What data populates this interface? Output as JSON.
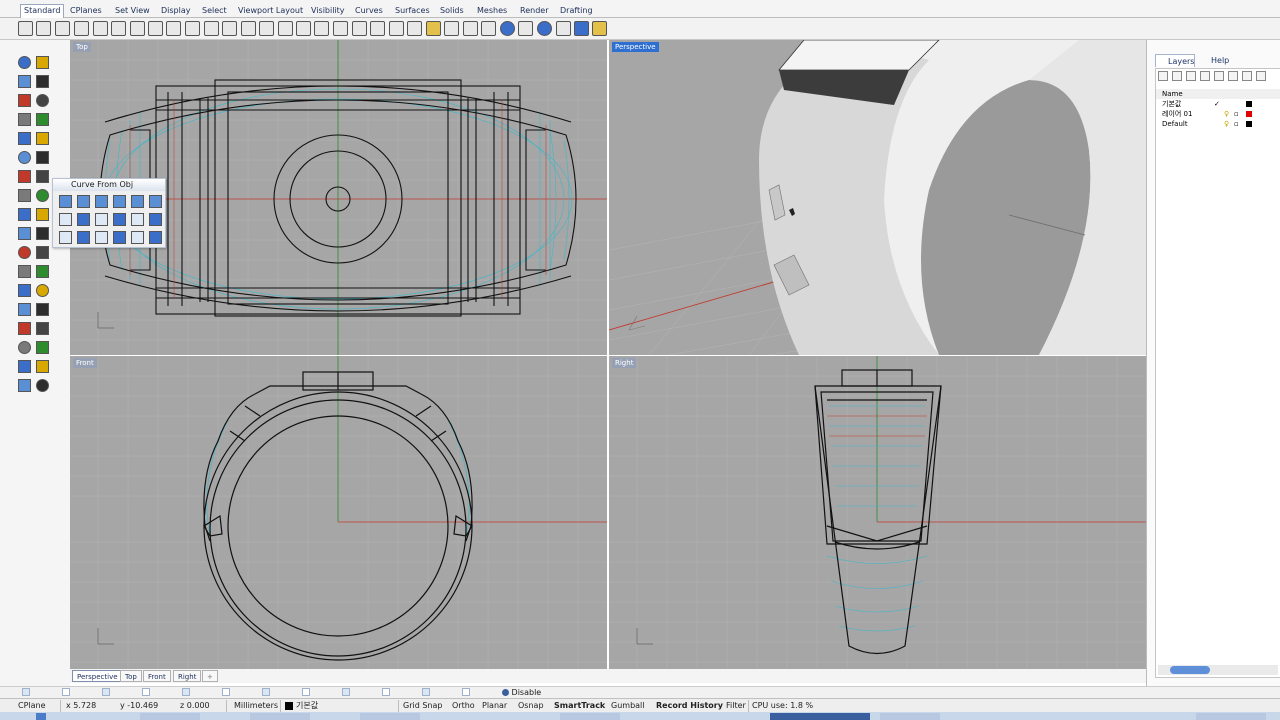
{
  "menu_tabs": [
    {
      "label": "Standard",
      "active": true
    },
    {
      "label": "CPlanes"
    },
    {
      "label": "Set View"
    },
    {
      "label": "Display"
    },
    {
      "label": "Select"
    },
    {
      "label": "Viewport Layout"
    },
    {
      "label": "Visibility"
    },
    {
      "label": "Curves"
    },
    {
      "label": "Surfaces"
    },
    {
      "label": "Solids"
    },
    {
      "label": "Meshes"
    },
    {
      "label": "Render"
    },
    {
      "label": "Drafting"
    }
  ],
  "toolbar": {
    "icons": [
      "new-icon",
      "open-icon",
      "save-icon",
      "print-icon",
      "import-icon",
      "cut-icon",
      "copy-icon",
      "paste-icon",
      "undo-icon",
      "redo-icon",
      "pan-icon",
      "rotate-view-icon",
      "zoom-icon",
      "zoom-window-icon",
      "zoom-extents-icon",
      "zoom-selected-icon",
      "zoom-all-icon",
      "four-viewports-icon",
      "cplane-icon",
      "show-objects-icon",
      "hide-objects-icon",
      "lock-icon",
      "light-icon",
      "lock-objects-icon",
      "layer-icon",
      "properties-icon",
      "color-wheel-icon",
      "render-preview-icon",
      "sphere-icon",
      "material-icon",
      "environment-icon",
      "sun-icon",
      "options-icon",
      "settings-icon",
      "help-icon"
    ]
  },
  "floating_toolbar": {
    "title": "Curve From Obj"
  },
  "viewports": {
    "top": {
      "label": "Top"
    },
    "perspective": {
      "label": "Perspective"
    },
    "front": {
      "label": "Front"
    },
    "right": {
      "label": "Right"
    }
  },
  "right_panel": {
    "tabs": [
      {
        "label": "Layers",
        "active": true
      },
      {
        "label": "Help"
      }
    ],
    "column_name": "Name",
    "layers": [
      {
        "name": "기본값",
        "current": true,
        "color": "#000000"
      },
      {
        "name": "레이어 01",
        "current": false,
        "color": "#e00000"
      },
      {
        "name": "Default",
        "current": false,
        "color": "#000000"
      }
    ]
  },
  "viewport_tabs": [
    "Perspective",
    "Top",
    "Front",
    "Right"
  ],
  "osnap": {
    "disable_label": "Disable"
  },
  "status": {
    "cplane": "CPlane",
    "x": "x 5.728",
    "y": "y -10.469",
    "z": "z 0.000",
    "units": "Millimeters",
    "layer": "기본값",
    "grid_snap": "Grid Snap",
    "ortho": "Ortho",
    "planar": "Planar",
    "osnap": "Osnap",
    "smarttrack": "SmartTrack",
    "gumball": "Gumball",
    "record_history": "Record History",
    "filter": "Filter",
    "cpu": "CPU use: 1.8 %"
  },
  "colors": {
    "viewport_bg": "#a6a6a6",
    "active_label": "#2f6fd0",
    "x_axis": "#c0392b",
    "y_axis": "#2e8b2e",
    "curve": "#111111",
    "isocurve": "#3fb7c9"
  }
}
